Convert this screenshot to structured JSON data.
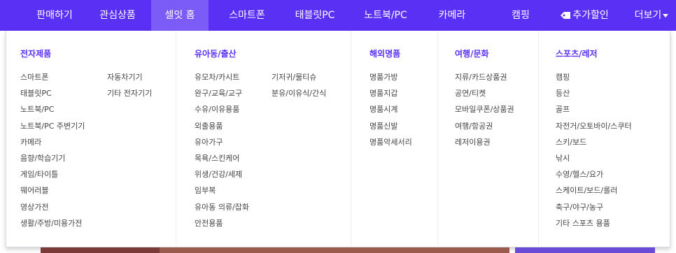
{
  "nav": {
    "items": [
      {
        "label": "판매하기"
      },
      {
        "label": "관심상품"
      },
      {
        "label": "셀잇 홈"
      },
      {
        "label": "스마트폰"
      },
      {
        "label": "태블릿PC"
      },
      {
        "label": "노트북/PC"
      },
      {
        "label": "카메라"
      },
      {
        "label": "캠핑"
      },
      {
        "label": "추가할인",
        "icon": "tag-icon"
      },
      {
        "label": "더보기",
        "icon": "caret-down-icon"
      }
    ],
    "active": "셀잇 홈",
    "bg_color": "#5a31f4",
    "active_color": "#7c5cf6"
  },
  "menu": {
    "columns": [
      {
        "title": "전자제품",
        "links": [
          "스마트폰",
          "태블릿PC",
          "노트북/PC",
          "노트북/PC 주변기기",
          "카메라",
          "음향/학습기기",
          "게임/타이틀",
          "웨어러블",
          "영상가전",
          "생활/주방/미용가전"
        ],
        "links2": [
          "자동차기기",
          "기타 전자기기"
        ]
      },
      {
        "title": "유아동/출산",
        "links": [
          "유모차/카시트",
          "완구/교육/교구",
          "수유/이유용품",
          "외출용품",
          "유아가구",
          "목욕/스킨케어",
          "위생/건강/세제",
          "임부복",
          "유아동 의류/잡화",
          "안전용품"
        ],
        "links2": [
          "기저귀/물티슈",
          "분유/이유식/간식"
        ]
      },
      {
        "title": "해외명품",
        "links": [
          "명품가방",
          "명품지갑",
          "명품시계",
          "명품신발",
          "명품악세서리"
        ]
      },
      {
        "title": "여행/문화",
        "links": [
          "지류/카드상품권",
          "공연/티켓",
          "모바일쿠폰/상품권",
          "여행/항공권",
          "레저이용권"
        ]
      },
      {
        "title": "스포츠/레저",
        "links": [
          "캠핑",
          "등산",
          "골프",
          "자전거/오토바이/스쿠터",
          "스키/보드",
          "낚시",
          "수영/헬스/요가",
          "스케이트/보드/롤러",
          "축구/야구/농구",
          "기타 스포츠 용품"
        ]
      }
    ],
    "title_color": "#5a31f4"
  }
}
